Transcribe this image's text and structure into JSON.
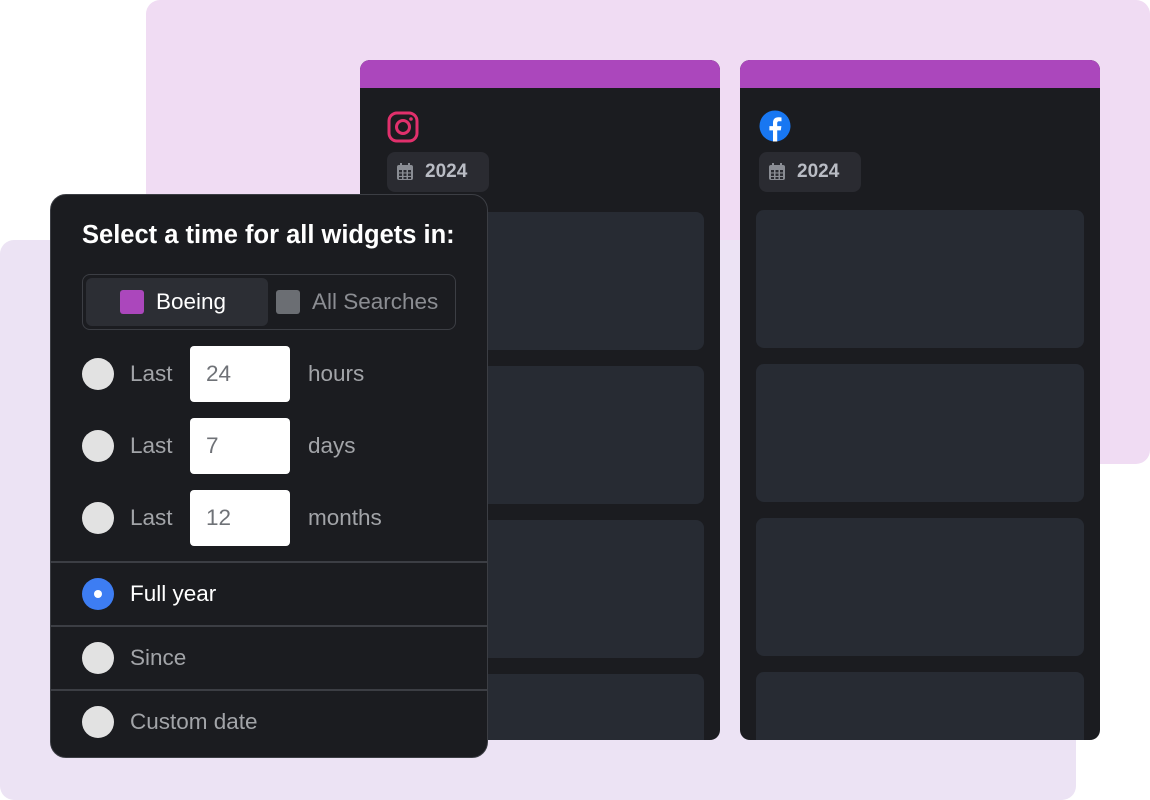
{
  "colors": {
    "accent_purple": "#ab47bc",
    "radio_selected": "#3d7df3",
    "panel_bg": "#1b1c20",
    "instagram_pink": "#e1306c",
    "facebook_blue": "#1877f2"
  },
  "widgets": [
    {
      "platform_icon": "instagram-icon",
      "year_label": "2024"
    },
    {
      "platform_icon": "facebook-icon",
      "year_label": "2024"
    }
  ],
  "time_panel": {
    "title": "Select a time for all widgets in:",
    "scope_toggle": {
      "options": [
        {
          "label": "Boeing",
          "selected": true
        },
        {
          "label": "All Searches",
          "selected": false
        }
      ]
    },
    "relative_options": [
      {
        "prefix": "Last",
        "value": "24",
        "unit": "hours",
        "selected": false
      },
      {
        "prefix": "Last",
        "value": "7",
        "unit": "days",
        "selected": false
      },
      {
        "prefix": "Last",
        "value": "12",
        "unit": "months",
        "selected": false
      }
    ],
    "other_options": [
      {
        "label": "Full year",
        "selected": true
      },
      {
        "label": "Since",
        "selected": false
      },
      {
        "label": "Custom date",
        "selected": false
      }
    ]
  }
}
